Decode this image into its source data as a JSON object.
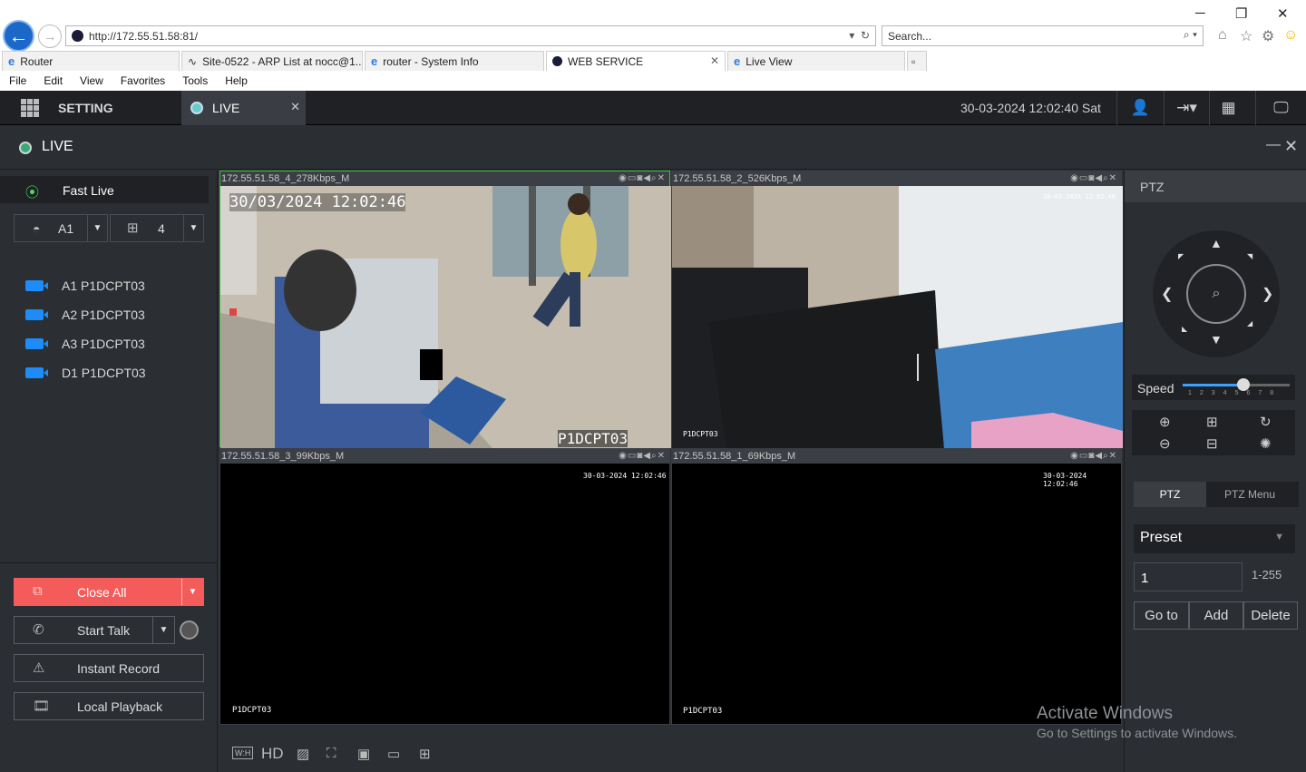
{
  "browser": {
    "url": "http://172.55.51.58:81/",
    "search_placeholder": "Search...",
    "tabs": [
      {
        "label": "Router"
      },
      {
        "label": "Site-0522 - ARP List at nocc@1..."
      },
      {
        "label": "router - System Info"
      },
      {
        "label": "WEB SERVICE"
      },
      {
        "label": "Live View"
      }
    ],
    "menu": [
      "File",
      "Edit",
      "View",
      "Favorites",
      "Tools",
      "Help"
    ]
  },
  "header": {
    "setting_label": "SETTING",
    "live_tab_label": "LIVE",
    "datetime": "30-03-2024 12:02:40 Sat"
  },
  "live_title": "LIVE",
  "left_panel": {
    "fast_live_label": "Fast Live",
    "channel_select": "A1",
    "layout_select": "4",
    "cameras": [
      "A1 P1DCPT03",
      "A2 P1DCPT03",
      "A3 P1DCPT03",
      "D1 P1DCPT03"
    ],
    "close_all": "Close All",
    "start_talk": "Start Talk",
    "instant_record": "Instant Record",
    "local_playback": "Local Playback"
  },
  "video_cells": [
    {
      "header": "172.55.51.58_4_278Kbps_M",
      "timestamp": "30/03/2024 12:02:46",
      "name": "P1DCPT03"
    },
    {
      "header": "172.55.51.58_2_526Kbps_M",
      "timestamp": "30-03-2024 12:02:46",
      "name": "P1DCPT03"
    },
    {
      "header": "172.55.51.58_3_99Kbps_M",
      "timestamp": "30-03-2024 12:02:46",
      "name": "P1DCPT03"
    },
    {
      "header": "172.55.51.58_1_69Kbps_M",
      "timestamp": "30-03-2024 12:02:46",
      "name": "P1DCPT03"
    }
  ],
  "bottom_bar": {
    "hd_label": "HD",
    "wh_label": "W:H"
  },
  "ptz": {
    "title": "PTZ",
    "speed_label": "Speed",
    "speed_ticks": "12345678",
    "speed_value": 5,
    "tab_ptz": "PTZ",
    "tab_ptz_menu": "PTZ Menu",
    "preset_label": "Preset",
    "preset_value": "1",
    "preset_range": "1-255",
    "goto": "Go to",
    "add": "Add",
    "delete": "Delete"
  },
  "watermark": {
    "line1": "Activate Windows",
    "line2": "Go to Settings to activate Windows."
  }
}
